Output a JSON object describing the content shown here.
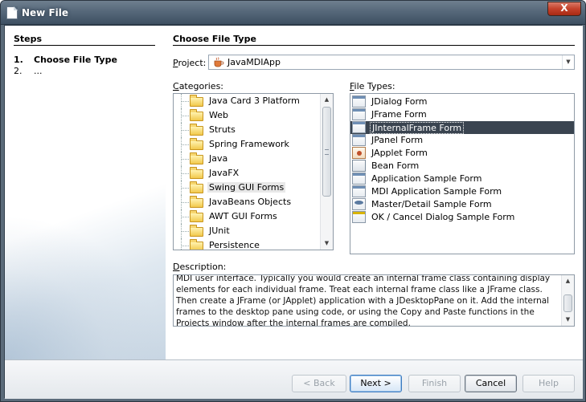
{
  "window": {
    "title": "New File",
    "close_label": "X"
  },
  "steps": {
    "heading": "Steps",
    "items": [
      {
        "num": "1.",
        "label": "Choose File Type"
      },
      {
        "num": "2.",
        "label": "..."
      }
    ]
  },
  "panel": {
    "heading": "Choose File Type"
  },
  "project": {
    "label_prefix": "",
    "label_key": "P",
    "label_rest": "roject:",
    "value": "JavaMDIApp"
  },
  "categories": {
    "label_key": "C",
    "label_rest": "ategories:",
    "selected": "Swing GUI Forms",
    "items": [
      "Java Card 3 Platform",
      "Web",
      "Struts",
      "Spring Framework",
      "Java",
      "JavaFX",
      "Swing GUI Forms",
      "JavaBeans Objects",
      "AWT GUI Forms",
      "JUnit",
      "Persistence"
    ]
  },
  "file_types": {
    "label_key": "F",
    "label_rest": "ile Types:",
    "selected": "JInternalFrame Form",
    "items": [
      {
        "label": "JDialog Form",
        "icon": "dialog-icon"
      },
      {
        "label": "JFrame Form",
        "icon": "frame-icon"
      },
      {
        "label": "JInternalFrame Form",
        "icon": "internal-frame-icon"
      },
      {
        "label": "JPanel Form",
        "icon": "panel-icon"
      },
      {
        "label": "JApplet Form",
        "icon": "applet-icon"
      },
      {
        "label": "Bean Form",
        "icon": "bean-icon"
      },
      {
        "label": "Application Sample Form",
        "icon": "application-icon"
      },
      {
        "label": "MDI Application Sample Form",
        "icon": "mdi-icon"
      },
      {
        "label": "Master/Detail Sample Form",
        "icon": "database-icon"
      },
      {
        "label": "OK / Cancel Dialog Sample Form",
        "icon": "ok-dialog-icon"
      }
    ]
  },
  "description": {
    "label_key": "D",
    "label_rest": "escription:",
    "text": "MDI user interface. Typically you would create an internal frame class containing display elements for each individual frame. Treat each internal frame class like a JFrame class. Then create a JFrame (or JApplet) application with a JDesktopPane on it. Add the internal frames to the desktop pane using code, or using the Copy and Paste functions in the Projects window after the internal frames are compiled."
  },
  "buttons": {
    "back": "< Back",
    "next": "Next >",
    "finish": "Finish",
    "cancel": "Cancel",
    "help": "Help"
  }
}
